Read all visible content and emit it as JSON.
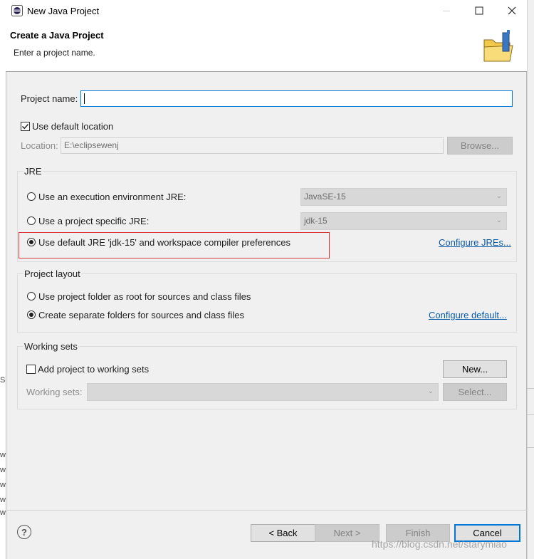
{
  "window": {
    "title": "New Java Project",
    "controls": [
      "minimize-icon",
      "maximize-icon",
      "close-icon"
    ]
  },
  "header": {
    "title": "Create a Java Project",
    "subtitle": "Enter a project name.",
    "icon": "java-folder-icon"
  },
  "form": {
    "project_name_label": "Project name:",
    "project_name_value": "",
    "use_default_location_label": "Use default location",
    "use_default_location_checked": true,
    "location_label": "Location:",
    "location_value": "E:\\eclipsewenj",
    "browse_label": "Browse..."
  },
  "jre": {
    "group_label": "JRE",
    "option_env_label": "Use an execution environment JRE:",
    "option_env_value": "JavaSE-15",
    "option_specific_label": "Use a project specific JRE:",
    "option_specific_value": "jdk-15",
    "option_default_label": "Use default JRE 'jdk-15' and workspace compiler preferences",
    "selected": "default",
    "configure_link": "Configure JREs..."
  },
  "layout": {
    "group_label": "Project layout",
    "option_root_label": "Use project folder as root for sources and class files",
    "option_separate_label": "Create separate folders for sources and class files",
    "selected": "separate",
    "configure_link": "Configure default..."
  },
  "working_sets": {
    "group_label": "Working sets",
    "add_label": "Add project to working sets",
    "add_checked": false,
    "new_button": "New...",
    "sets_label": "Working sets:",
    "sets_value": "",
    "select_button": "Select..."
  },
  "footer": {
    "back": "< Back",
    "next": "Next >",
    "finish": "Finish",
    "cancel": "Cancel",
    "help_icon": "help-icon"
  },
  "background": {
    "left_slice_texts": [
      "Se",
      "w",
      "w",
      "w",
      "w",
      "w"
    ]
  },
  "watermark": "https://blog.csdn.net/starymiao",
  "colors": {
    "accent": "#0078d7",
    "highlight_box": "#d63a3a",
    "link": "#0a5aa8"
  }
}
